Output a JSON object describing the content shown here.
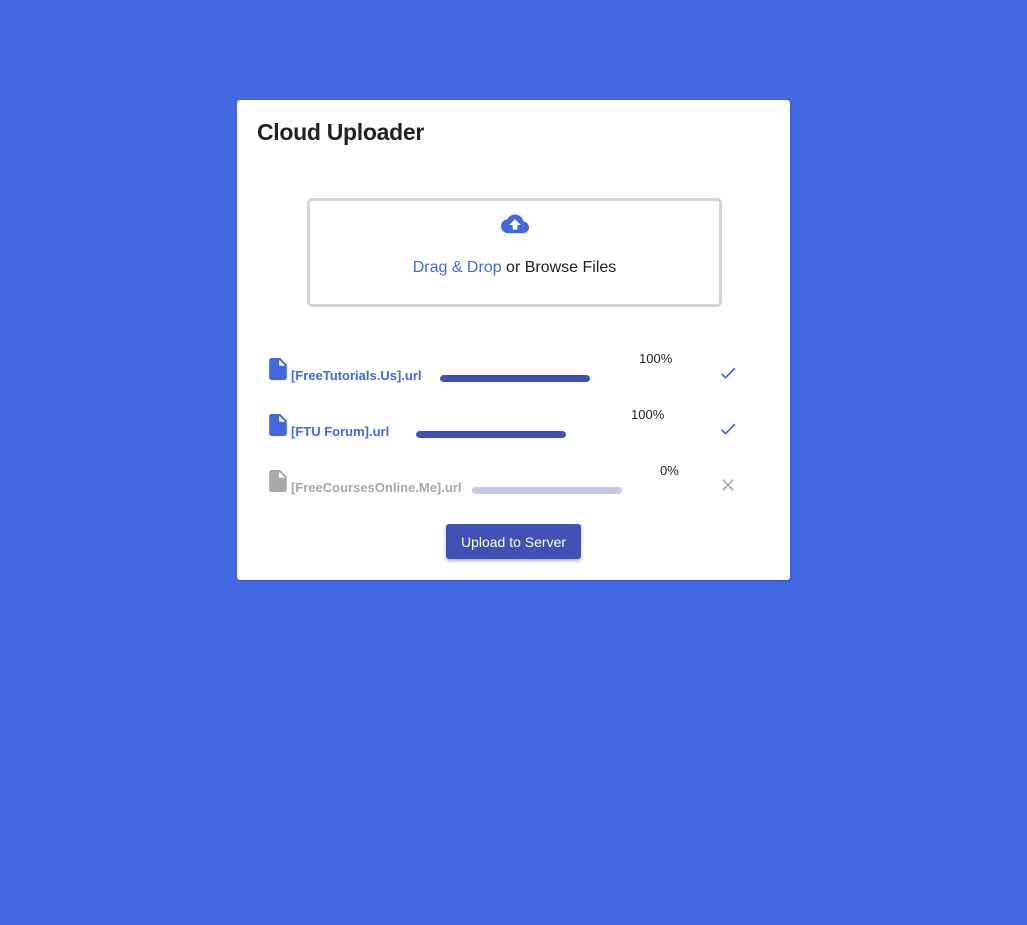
{
  "app": {
    "title": "Cloud Uploader"
  },
  "dropzone": {
    "icon": "cloud-upload-icon",
    "link_text": "Drag & Drop",
    "rest_text": " or Browse Files"
  },
  "files": [
    {
      "name": "[FreeTutorials.Us].url",
      "progress_percent": 100,
      "percent_label": "100%",
      "status": "complete",
      "status_icon": "check-icon"
    },
    {
      "name": "[FTU Forum].url",
      "progress_percent": 100,
      "percent_label": "100%",
      "status": "complete",
      "status_icon": "check-icon"
    },
    {
      "name": "[FreeCoursesOnline.Me].url",
      "progress_percent": 0,
      "percent_label": "0%",
      "status": "failed",
      "status_icon": "close-icon"
    }
  ],
  "actions": {
    "upload_label": "Upload to Server"
  },
  "colors": {
    "background": "#4169e1",
    "accent": "#4169e1",
    "progress": "#3f51b5",
    "progress_track": "#c5cae9",
    "button": "#3f51b5",
    "disabled": "#a8a8a8"
  }
}
